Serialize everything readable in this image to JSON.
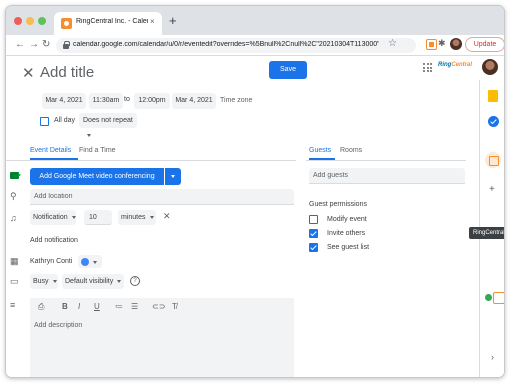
{
  "browser": {
    "tab_title": "RingCentral Inc. - Calendar – E",
    "tab_close": "×",
    "new_tab": "+",
    "url": "calendar.google.com/calendar/u/0/r/eventedit?overrides=%5Bnull%2Cnull%2C\"20210304T113000\"%...",
    "update_label": "Update",
    "nav": {
      "back": "←",
      "forward": "→",
      "reload": "↻"
    },
    "star": "☆",
    "puzzle": "✱"
  },
  "header": {
    "close": "✕",
    "title_placeholder": "Add title",
    "save_label": "Save",
    "brand": {
      "ring": "Ring",
      "central": "Central"
    }
  },
  "datetime": {
    "start_date": "Mar 4, 2021",
    "start_time": "11:30am",
    "to": "to",
    "end_time": "12:00pm",
    "end_date": "Mar 4, 2021",
    "time_zone": "Time zone",
    "all_day": "All day",
    "repeat": "Does not repeat"
  },
  "tabs": {
    "event_details": "Event Details",
    "find_time": "Find a Time"
  },
  "details": {
    "meet_button": "Add Google Meet video conferencing",
    "location_placeholder": "Add location",
    "notification_type": "Notification",
    "notification_value": "10",
    "notification_unit": "minutes",
    "remove": "✕",
    "add_notification": "Add notification",
    "owner": "Kathryn Conti",
    "busy": "Busy",
    "visibility": "Default visibility",
    "help": "?",
    "description_placeholder": "Add description",
    "toolbar": {
      "attach": "⎙",
      "bold": "B",
      "italic": "I",
      "underline": "U",
      "numbered": "≔",
      "bulleted": "☰",
      "link": "⊂⊃",
      "clear": "T̸"
    }
  },
  "icons": {
    "location": "⚲",
    "bell": "♫",
    "calendar": "▦",
    "briefcase": "▭",
    "lines": "≡"
  },
  "guests": {
    "tab_guests": "Guests",
    "tab_rooms": "Rooms",
    "add_placeholder": "Add guests",
    "permissions_title": "Guest permissions",
    "permissions": [
      {
        "label": "Modify event",
        "checked": false
      },
      {
        "label": "Invite others",
        "checked": true
      },
      {
        "label": "See guest list",
        "checked": true
      }
    ]
  },
  "side_panel": {
    "tooltip": "RingCentral",
    "plus": "+",
    "chevron": "›"
  },
  "colors": {
    "accent": "#1a73e8",
    "brand_orange": "#f68d2e",
    "online": "#34a853"
  }
}
